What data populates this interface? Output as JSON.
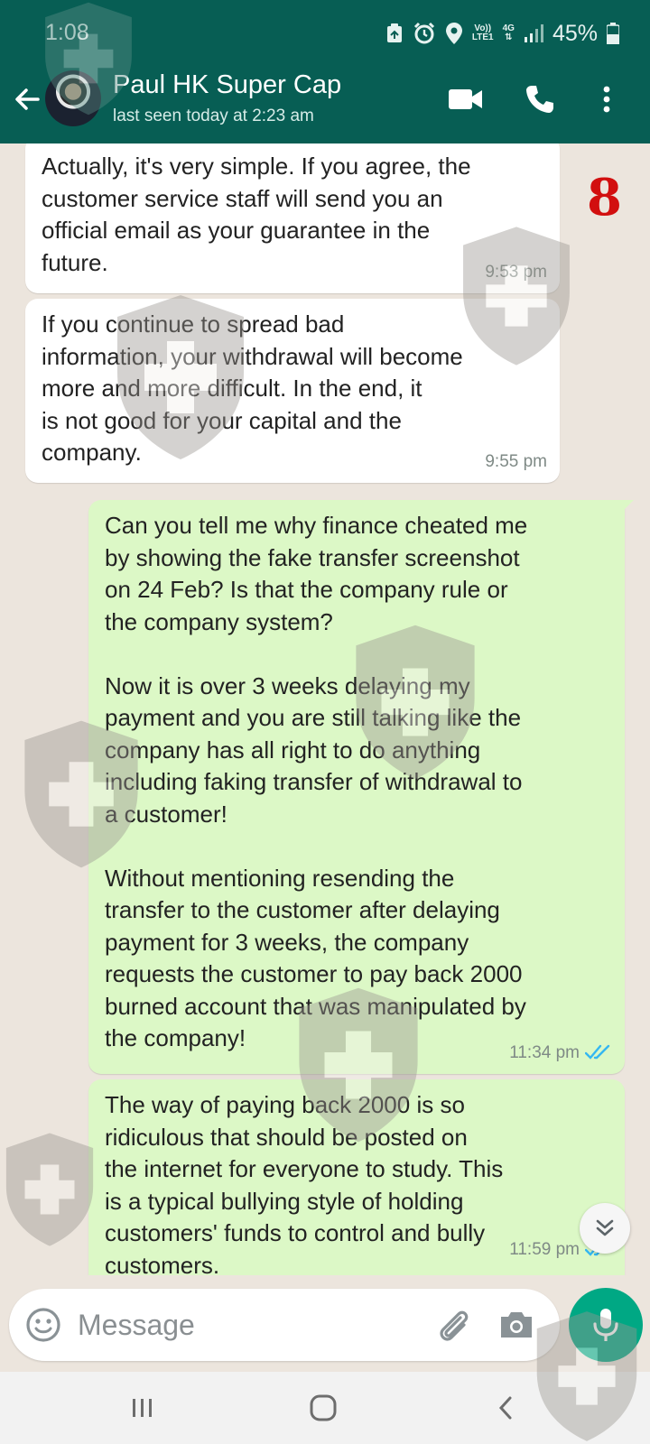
{
  "status_bar": {
    "time": "1:08",
    "volte_label": "Vo))",
    "lte_label": "LTE1",
    "network_label": "4G",
    "battery": "45%"
  },
  "header": {
    "contact_name": "Paul HK Super Cap",
    "last_seen": "last seen today at 2:23 am",
    "icons": [
      "back-arrow-icon",
      "video-call-icon",
      "voice-call-icon",
      "more-options-icon"
    ]
  },
  "page_number": "8",
  "messages": [
    {
      "direction": "incoming",
      "text": "Actually, it's very simple. If you agree, the\ncustomer service staff will send you an\nofficial email as your guarantee in the\nfuture.",
      "time": "9:53 pm"
    },
    {
      "direction": "incoming",
      "text": "If you continue to spread bad\ninformation, your withdrawal will become\nmore and more difficult. In the end, it\nis not good for your capital and the\ncompany.",
      "time": "9:55 pm"
    },
    {
      "direction": "outgoing",
      "text": "Can you tell me why finance cheated me\nby showing the fake transfer screenshot\non 24 Feb? Is that the company rule or\nthe company system?\n\nNow it is over 3 weeks delaying my\npayment and you are still talking like the\ncompany has all right to do anything\nincluding faking transfer of withdrawal to\na  customer!\n\nWithout mentioning resending the\ntransfer to the customer after delaying\npayment for 3 weeks, the company\nrequests the customer to pay back 2000\nburned account that was manipulated by\nthe company!",
      "time": "11:34 pm",
      "read_icon": "double-check-icon"
    },
    {
      "direction": "outgoing",
      "text": "The way of paying back 2000 is so\nridiculous that should be posted on\nthe internet for everyone to study. This\nis a typical bullying style of holding\ncustomers' funds to control and bully\ncustomers.",
      "time": "11:59 pm",
      "read_icon": "double-check-icon"
    }
  ],
  "input": {
    "placeholder": "Message"
  },
  "colors": {
    "header": "#075e54",
    "incoming_bubble": "#ffffff",
    "outgoing_bubble": "#dcf8c6",
    "chat_background": "#ece5dd",
    "read_ticks": "#34b7f1",
    "mic_button": "#00a884",
    "page_number": "#d20f0f"
  }
}
